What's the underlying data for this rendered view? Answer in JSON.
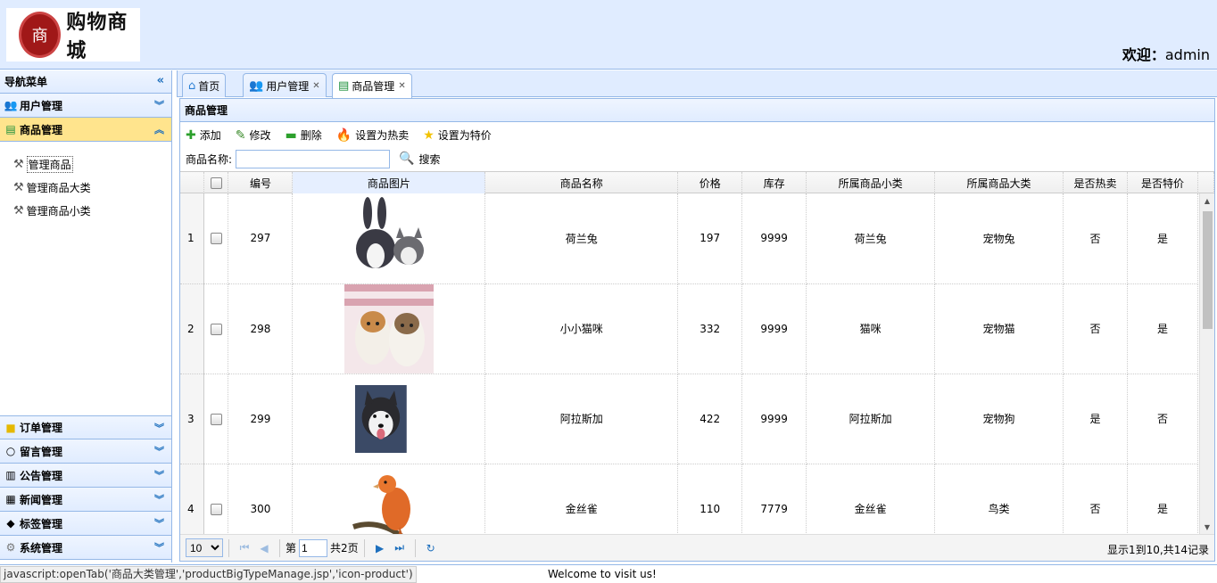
{
  "header": {
    "brand": "购物商城",
    "welcome_label": "欢迎：",
    "user": "admin"
  },
  "sidebar": {
    "title": "导航菜单",
    "groups": [
      {
        "label": "用户管理",
        "icon": "users-icon"
      },
      {
        "label": "商品管理",
        "icon": "list-icon",
        "active": true,
        "items": [
          "管理商品",
          "管理商品大类",
          "管理商品小类"
        ]
      },
      {
        "label": "订单管理",
        "icon": "folder-icon"
      },
      {
        "label": "留言管理",
        "icon": "speech-bubble-icon"
      },
      {
        "label": "公告管理",
        "icon": "notice-icon"
      },
      {
        "label": "新闻管理",
        "icon": "newspaper-icon"
      },
      {
        "label": "标签管理",
        "icon": "tag-icon"
      },
      {
        "label": "系统管理",
        "icon": "gear-icon"
      }
    ]
  },
  "tabs": [
    {
      "label": "首页",
      "icon": "home-icon",
      "closable": false
    },
    {
      "label": "用户管理",
      "icon": "users-icon",
      "closable": true
    },
    {
      "label": "商品管理",
      "icon": "list-icon",
      "closable": true,
      "active": true
    }
  ],
  "panel": {
    "title": "商品管理",
    "toolbar": {
      "add": "添加",
      "edit": "修改",
      "delete": "删除",
      "set_hot": "设置为热卖",
      "set_special": "设置为特价"
    },
    "search": {
      "label": "商品名称:",
      "value": "",
      "button": "搜索"
    }
  },
  "grid": {
    "columns": [
      "编号",
      "商品图片",
      "商品名称",
      "价格",
      "库存",
      "所属商品小类",
      "所属商品大类",
      "是否热卖",
      "是否特价"
    ],
    "rows": [
      {
        "rownum": "1",
        "id": "297",
        "image": "rabbit-cat-photo",
        "name": "荷兰兔",
        "price": "197",
        "stock": "9999",
        "small_type": "荷兰兔",
        "big_type": "宠物兔",
        "hot": "否",
        "special": "是"
      },
      {
        "rownum": "2",
        "id": "298",
        "image": "kittens-photo",
        "name": "小小猫咪",
        "price": "332",
        "stock": "9999",
        "small_type": "猫咪",
        "big_type": "宠物猫",
        "hot": "否",
        "special": "是"
      },
      {
        "rownum": "3",
        "id": "299",
        "image": "husky-photo",
        "name": "阿拉斯加",
        "price": "422",
        "stock": "9999",
        "small_type": "阿拉斯加",
        "big_type": "宠物狗",
        "hot": "是",
        "special": "否"
      },
      {
        "rownum": "4",
        "id": "300",
        "image": "canary-photo",
        "name": "金丝雀",
        "price": "110",
        "stock": "7779",
        "small_type": "金丝雀",
        "big_type": "鸟类",
        "hot": "否",
        "special": "是"
      }
    ]
  },
  "pager": {
    "page_size": "10",
    "page_prefix": "第",
    "page_value": "1",
    "page_total": "共2页",
    "info": "显示1到10,共14记录"
  },
  "statusbar": {
    "url": "javascript:openTab('商品大类管理','productBigTypeManage.jsp','icon-product')",
    "message": "Welcome to visit us!"
  }
}
